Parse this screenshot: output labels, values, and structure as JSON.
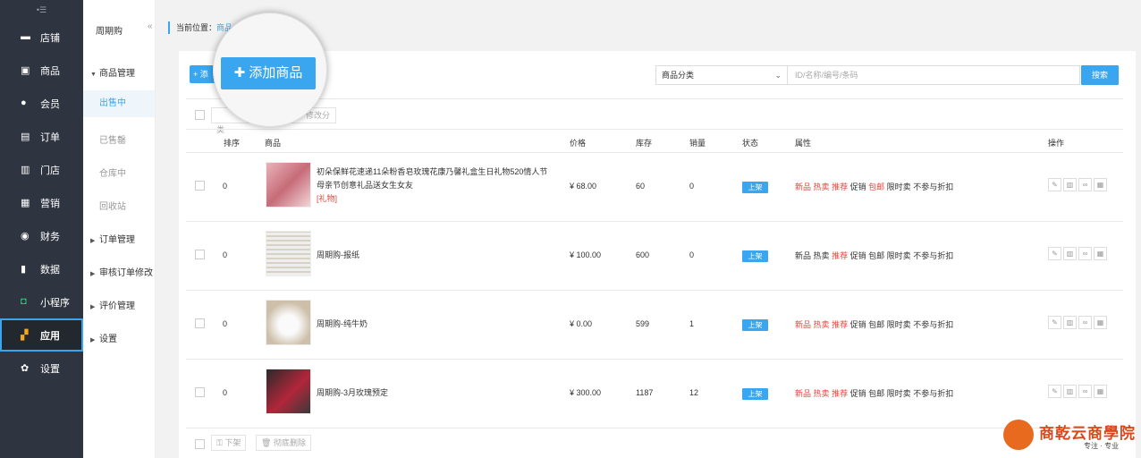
{
  "sidebar": {
    "items": [
      {
        "label": "店铺",
        "icon": "store-icon"
      },
      {
        "label": "商品",
        "icon": "goods-icon"
      },
      {
        "label": "会员",
        "icon": "member-icon"
      },
      {
        "label": "订单",
        "icon": "order-icon"
      },
      {
        "label": "门店",
        "icon": "shop-icon"
      },
      {
        "label": "营销",
        "icon": "marketing-icon"
      },
      {
        "label": "财务",
        "icon": "finance-icon"
      },
      {
        "label": "数据",
        "icon": "data-icon"
      },
      {
        "label": "小程序",
        "icon": "miniprogram-icon"
      },
      {
        "label": "应用",
        "icon": "apps-icon",
        "active": true
      },
      {
        "label": "设置",
        "icon": "gear-icon"
      }
    ]
  },
  "subnav": {
    "title": "周期购",
    "groups": [
      "商品管理",
      "订单管理",
      "审核订单修改",
      "评价管理",
      "设置"
    ],
    "items": [
      "出售中",
      "已售罄",
      "仓库中",
      "回收站"
    ]
  },
  "breadcrumb": {
    "prefix": "当前位置：",
    "link": "商品"
  },
  "toolbar": {
    "add_small": "+ 添",
    "add_label": "添加商品",
    "category_placeholder": "商品分类",
    "search_placeholder": "ID/名称/编号/条码",
    "search_button": "搜索",
    "batch_category": "修改分类",
    "bottom_off": "下架",
    "bottom_delete": "彻底删除"
  },
  "table": {
    "headers": [
      "排序",
      "商品",
      "价格",
      "库存",
      "销量",
      "状态",
      "属性",
      "操作"
    ],
    "rows": [
      {
        "order": "0",
        "name": "初朵保鲜花速递11朵粉香皂玫瑰花康乃馨礼盒生日礼物520情人节母亲节创意礼品送女生女友",
        "tag": "[礼物]",
        "price": "¥ 68.00",
        "stock": "60",
        "sales": "0",
        "status": "上架",
        "attrs": {
          "new": "新品",
          "hot": "热卖",
          "rec": "推荐",
          "promo": "促销",
          "free": "包邮",
          "limit": "限时卖",
          "nodisc": "不参与折扣"
        }
      },
      {
        "order": "0",
        "name": "周期购-报纸",
        "tag": "",
        "price": "¥ 100.00",
        "stock": "600",
        "sales": "0",
        "status": "上架",
        "attrs": {
          "new": "新品",
          "hot": "热卖",
          "rec": "推荐",
          "promo": "促销",
          "free": "包邮",
          "limit": "限时卖",
          "nodisc": "不参与折扣"
        }
      },
      {
        "order": "0",
        "name": "周期购-纯牛奶",
        "tag": "",
        "price": "¥ 0.00",
        "stock": "599",
        "sales": "1",
        "status": "上架",
        "attrs": {
          "new": "新品",
          "hot": "热卖",
          "rec": "推荐",
          "promo": "促销",
          "free": "包邮",
          "limit": "限时卖",
          "nodisc": "不参与折扣"
        }
      },
      {
        "order": "0",
        "name": "周期购-3月玫瑰预定",
        "tag": "",
        "price": "¥ 300.00",
        "stock": "1187",
        "sales": "12",
        "status": "上架",
        "attrs": {
          "new": "新品",
          "hot": "热卖",
          "rec": "推荐",
          "promo": "促销",
          "free": "包邮",
          "limit": "限时卖",
          "nodisc": "不参与折扣"
        }
      }
    ]
  },
  "logo": {
    "name": "商乾云商學院",
    "slogan": "专注 · 专业"
  },
  "colors": {
    "accent": "#3aa6f0",
    "sidebar": "#2f3540",
    "tag_red": "#e8453c"
  }
}
